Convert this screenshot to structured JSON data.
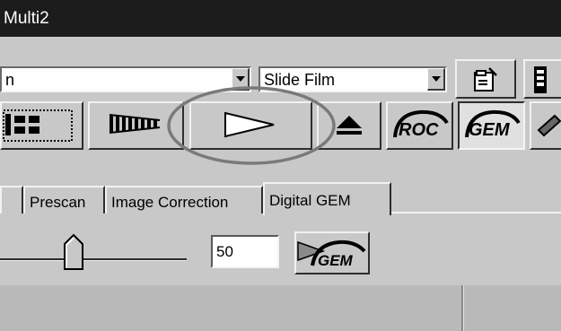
{
  "window": {
    "title": "Multi2"
  },
  "toolbar1": {
    "left_combo_value": "n",
    "film_type_value": "Slide Film"
  },
  "toolbar2": {
    "buttons": {
      "frame_select": "frame-select-icon",
      "filmstrip_scan": "filmstrip-scan-icon",
      "play": "play-icon",
      "eject": "eject-icon",
      "roc": "ROC",
      "gem": "GEM"
    },
    "annotation": "ellipse highlighting the play button"
  },
  "tabs": [
    {
      "label": "Prescan"
    },
    {
      "label": "Image Correction"
    },
    {
      "label": "Digital GEM",
      "active": true
    }
  ],
  "gem": {
    "slider_value": 50,
    "value_text": "50",
    "apply_label": "GEM"
  },
  "colors": {
    "titlebar": "#1c1c1c",
    "face": "#c8c8c8",
    "annotation": "#7a7a7a"
  }
}
